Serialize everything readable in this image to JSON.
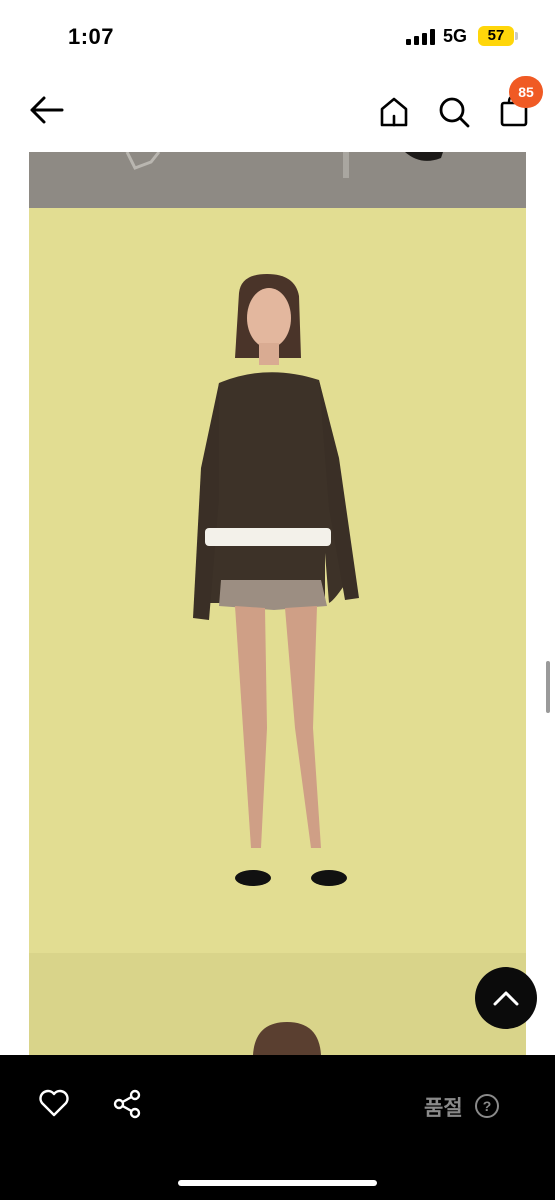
{
  "status_bar": {
    "time": "1:07",
    "network": "5G",
    "battery": "57"
  },
  "header": {
    "cart_count": "85"
  },
  "bottom_bar": {
    "status_label": "품절",
    "help_symbol": "?"
  },
  "icons": {
    "back": "arrow-left-icon",
    "home": "home-icon",
    "search": "search-icon",
    "cart": "bag-icon",
    "like": "heart-icon",
    "share": "share-icon",
    "to_top": "chevron-up-icon"
  },
  "colors": {
    "badge": "#f05a24",
    "photo_background": "#e2dd92",
    "bottom_bar": "#000000"
  }
}
